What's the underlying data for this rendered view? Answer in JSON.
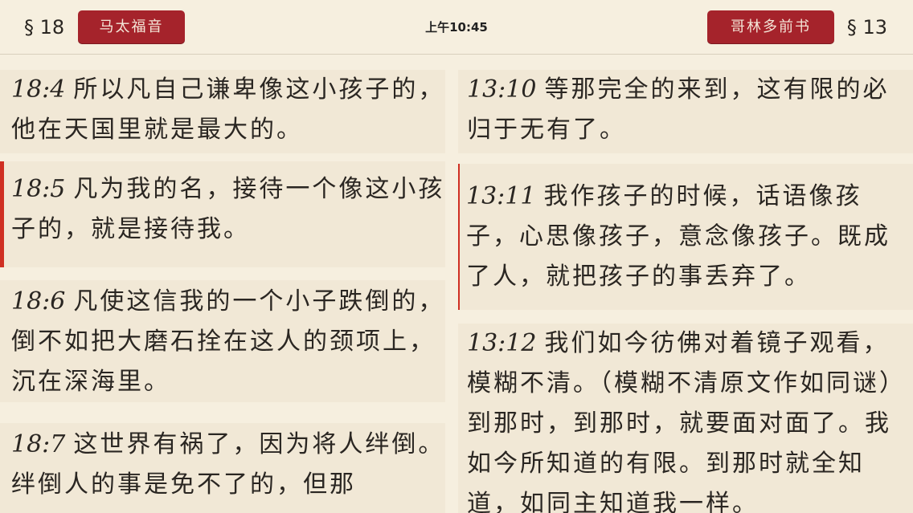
{
  "header": {
    "left_section": "§ 18",
    "left_book": "马太福音",
    "time": "上午10:45",
    "right_book": "哥林多前书",
    "right_section": "§ 13"
  },
  "left_verses": [
    {
      "ref": "18:4",
      "text": "所以凡自己谦卑像这小孩子的，他在天国里就是最大的。",
      "active": false
    },
    {
      "ref": "18:5",
      "text": "凡为我的名，接待一个像这小孩子的，就是接待我。",
      "active": true
    },
    {
      "ref": "18:6",
      "text": "凡使这信我的一个小子跌倒的，倒不如把大磨石拴在这人的颈项上，沉在深海里。",
      "active": false
    },
    {
      "ref": "18:7",
      "text": "这世界有祸了，因为将人绊倒。绊倒人的事是免不了的，但那",
      "active": false
    }
  ],
  "right_verses": [
    {
      "ref": "13:10",
      "text": "等那完全的来到，这有限的必归于无有了。",
      "active": false
    },
    {
      "ref": "13:11",
      "text": "我作孩子的时候，话语像孩子，心思像孩子，意念像孩子。既成了人，就把孩子的事丢弃了。",
      "active": true
    },
    {
      "ref": "13:12",
      "text": "我们如今彷佛对着镜子观看，模糊不清。（模糊不清原文作如同谜）到那时，到那时，就要面对面了。我如今所知道的有限。到那时就全知道，如同主知道我一样。",
      "active": false
    }
  ]
}
